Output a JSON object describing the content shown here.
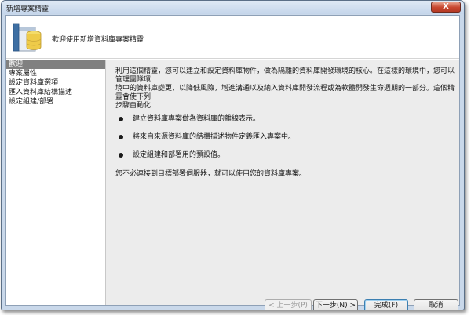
{
  "window": {
    "title": "新增專案精靈",
    "close_glyph": "X"
  },
  "header": {
    "title": "歡迎使用新增資料庫專案精靈",
    "icon": "database-icon"
  },
  "sidebar": {
    "items": [
      {
        "label": "歡迎",
        "active": true
      },
      {
        "label": "專案屬性",
        "active": false
      },
      {
        "label": "設定資料庫選項",
        "active": false
      },
      {
        "label": "匯入資料庫結構描述",
        "active": false
      },
      {
        "label": "設定組建/部署",
        "active": false
      }
    ]
  },
  "content": {
    "intro_line1": "利用這個精靈，您可以建立和設定資料庫物件，做為隔離的資料庫開發環境的核心。在這樣的環境中，您可以管理團隊環",
    "intro_line2": "境中的資料庫變更，以降低風險，增進溝通以及納入資料庫開發流程或為軟體開發生命週期的一部分。這個精靈會使下列",
    "intro_line3": "步驟自動化:",
    "bullets": [
      "建立資料庫專案做為資料庫的離線表示。",
      "將來自來源資料庫的結構描述物件定義匯入專案中。",
      "設定組建和部署用的預設值。"
    ],
    "note": "您不必連接到目標部署伺服器，就可以使用您的資料庫專案。"
  },
  "buttons": {
    "prev": "< 上一步(P)",
    "next": "下一步(N) >",
    "finish": "完成(F)",
    "cancel": "取消"
  },
  "colors": {
    "sidebar_active": "#808080",
    "content_bg": "#ececec",
    "frame": "#c9d8ea"
  }
}
